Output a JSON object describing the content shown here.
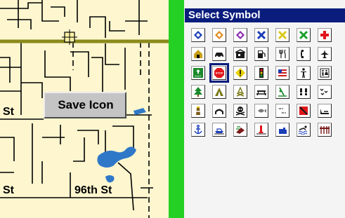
{
  "map": {
    "save_button_label": "Save Icon",
    "streets": {
      "st_left_mid": "St",
      "st_left_bottom": "St",
      "st_bottom": "96th St"
    }
  },
  "panel": {
    "title": "Select Symbol",
    "selected": "stop-sign",
    "rows": [
      [
        {
          "name": "diamond-blue",
          "fg": "#1a3db8"
        },
        {
          "name": "diamond-orange",
          "fg": "#e08a1a"
        },
        {
          "name": "diamond-purple",
          "fg": "#8a2ab0"
        },
        {
          "name": "x-blue",
          "fg": "#1a3db8"
        },
        {
          "name": "x-yellow",
          "fg": "#d9c91a"
        },
        {
          "name": "x-green",
          "fg": "#1aa02a"
        },
        {
          "name": "cross-red",
          "fg": "#e0161a"
        }
      ],
      [
        {
          "name": "house",
          "fg": "#c8a018"
        },
        {
          "name": "car",
          "fg": "#1a1a1a"
        },
        {
          "name": "gas-station",
          "fg": "#1a1a1a"
        },
        {
          "name": "fuel-pump",
          "fg": "#1a1a1a"
        },
        {
          "name": "restaurant",
          "fg": "#1a1a1a"
        },
        {
          "name": "phone",
          "fg": "#1a1a1a"
        },
        {
          "name": "airplane",
          "fg": "#1a1a1a"
        }
      ],
      [
        {
          "name": "exit-sign",
          "fg": "#1a8a2a",
          "text": "EXIT"
        },
        {
          "name": "stop-sign",
          "fg": "#e0161a",
          "text": "STOP"
        },
        {
          "name": "warning",
          "fg": "#e8d000"
        },
        {
          "name": "traffic-light",
          "fg": "#1a1a1a"
        },
        {
          "name": "flag-usa",
          "fg": "#cc1a1a"
        },
        {
          "name": "person",
          "fg": "#1a1a1a"
        },
        {
          "name": "restroom",
          "fg": "#1a1a1a"
        }
      ],
      [
        {
          "name": "tree",
          "fg": "#1a8a2a"
        },
        {
          "name": "tent",
          "fg": "#7a7a18"
        },
        {
          "name": "campfire",
          "fg": "#7a7a18"
        },
        {
          "name": "picnic-table",
          "fg": "#1a1a1a"
        },
        {
          "name": "fishing",
          "fg": "#1a8a2a"
        },
        {
          "name": "tracks",
          "fg": "#1a1a1a"
        },
        {
          "name": "birds",
          "fg": "#1a1a1a"
        }
      ],
      [
        {
          "name": "lighthouse",
          "fg": "#7a5a18"
        },
        {
          "name": "bridge",
          "fg": "#1a1a1a"
        },
        {
          "name": "skull-crossbones",
          "fg": "#1a1a1a"
        },
        {
          "name": "fish",
          "fg": "#7a7a7a"
        },
        {
          "name": "fish-school",
          "fg": "#7a7a7a"
        },
        {
          "name": "no-entry",
          "fg": "#e0161a"
        },
        {
          "name": "boat-ramp",
          "fg": "#1a1a1a"
        }
      ],
      [
        {
          "name": "anchor",
          "fg": "#1a3db8"
        },
        {
          "name": "boat",
          "fg": "#1a3db8"
        },
        {
          "name": "shipwreck",
          "fg": "#7a1a1a"
        },
        {
          "name": "buoy",
          "fg": "#e0161a"
        },
        {
          "name": "boat-blue",
          "fg": "#1a3db8"
        },
        {
          "name": "swimmer",
          "fg": "#1a1a1a"
        },
        {
          "name": "dock",
          "fg": "#7a1a1a"
        }
      ]
    ]
  }
}
